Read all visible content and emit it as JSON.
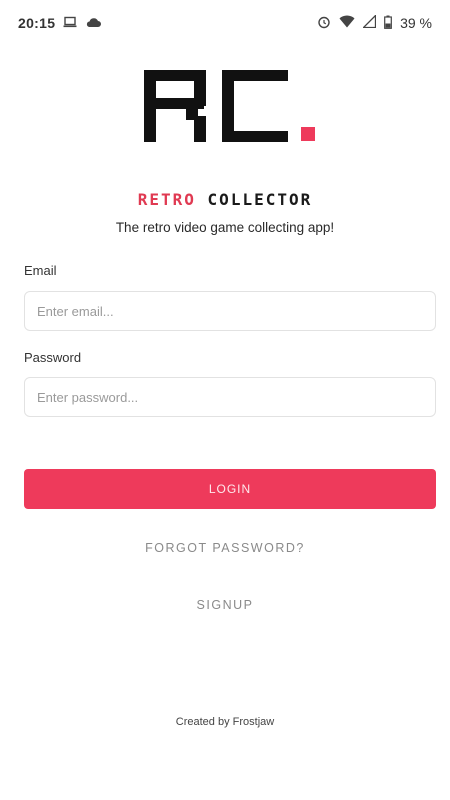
{
  "status_bar": {
    "time": "20:15",
    "battery": "39 %",
    "icons": [
      "laptop-icon",
      "cloud-icon",
      "alarm-icon",
      "wifi-icon",
      "signal-icon",
      "battery-icon"
    ]
  },
  "app": {
    "logo_text": "RC.",
    "title_part1": "RETRO",
    "title_part2": "COLLECTOR",
    "tagline": "The retro video game collecting app!"
  },
  "form": {
    "email_label": "Email",
    "email_placeholder": "Enter email...",
    "email_value": "",
    "password_label": "Password",
    "password_placeholder": "Enter password...",
    "password_value": ""
  },
  "actions": {
    "login_label": "LOGIN",
    "forgot_label": "FORGOT PASSWORD?",
    "signup_label": "SIGNUP"
  },
  "footer": {
    "credit": "Created by Frostjaw"
  },
  "colors": {
    "accent": "#ee3a5b",
    "title_red": "#e03a52",
    "logo_dark": "#111111"
  }
}
